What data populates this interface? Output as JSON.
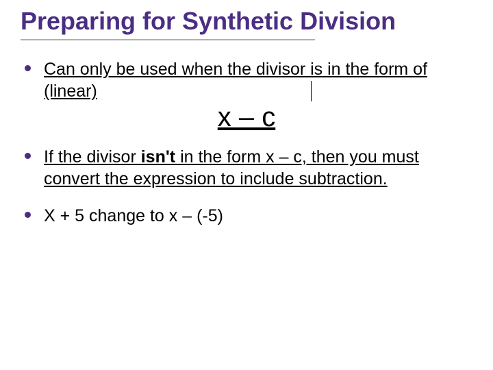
{
  "title": "Preparing for Synthetic Division",
  "bullets": {
    "b1_part1": "Can only be used when the divisor is in the form of (linear)",
    "formula": "x – c",
    "b2_pre": "If the divisor ",
    "b2_bold": "isn't",
    "b2_post": " in the form x – c, then you must convert the expression to include subtraction.",
    "b3": "X + 5 change to x – (-5)"
  }
}
